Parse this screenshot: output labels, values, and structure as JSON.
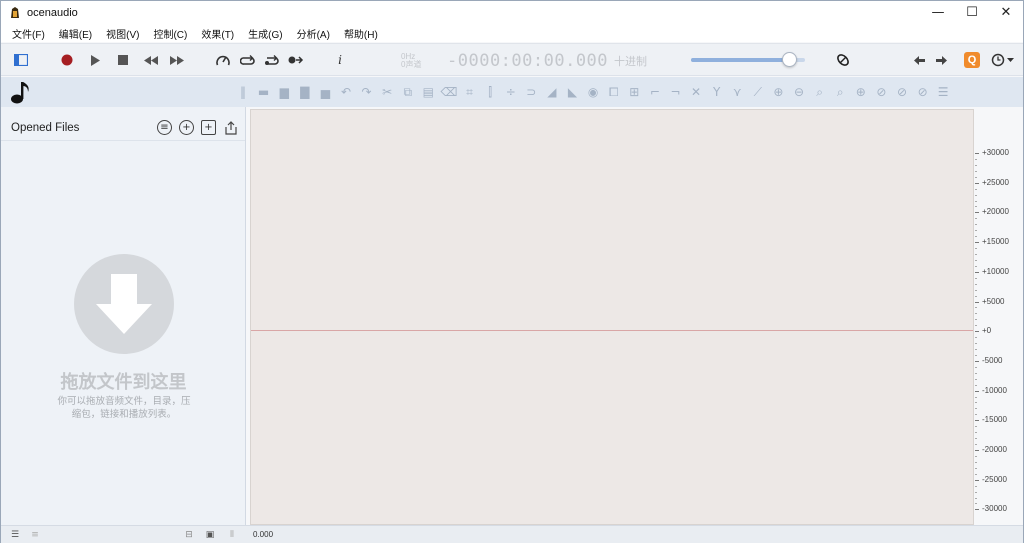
{
  "window": {
    "title": "ocenaudio",
    "minimize": "—",
    "maximize": "☐",
    "close": "✕"
  },
  "menu": [
    "文件(F)",
    "编辑(E)",
    "视图(V)",
    "控制(C)",
    "效果(T)",
    "生成(G)",
    "分析(A)",
    "帮助(H)"
  ],
  "toolbar": {
    "time": {
      "hz_label": "0Hz",
      "channels_label": "0声道",
      "value": "-0000:00:00.000",
      "unit": "十进制"
    },
    "volume_level": 0.86,
    "orange_button_glyph": "Q",
    "info_glyph": "i"
  },
  "left_panel": {
    "title": "Opened Files",
    "drop_title": "拖放文件到这里",
    "drop_subtitle_line1": "你可以拖放音频文件，目录，压",
    "drop_subtitle_line2": "缩包，链接和播放列表。"
  },
  "scale_labels": [
    "+30000",
    "+25000",
    "+20000",
    "+15000",
    "+10000",
    "+5000",
    "+0",
    "-5000",
    "-10000",
    "-15000",
    "-20000",
    "-25000",
    "-30000"
  ],
  "status": {
    "time": "0.000"
  },
  "colors": {
    "accent_red": "#a51e22",
    "volume_fill": "#8fb0dd",
    "orange": "#f08b2c",
    "zero_line": "#d9a6a6"
  }
}
